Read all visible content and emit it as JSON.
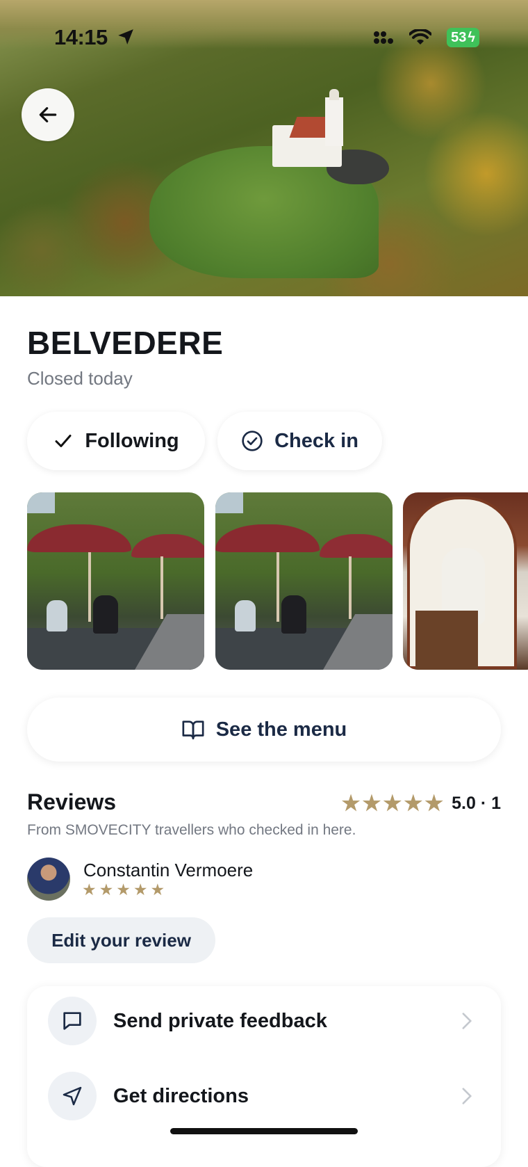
{
  "status_bar": {
    "time": "14:15",
    "battery": "53"
  },
  "venue": {
    "name": "BELVEDERE",
    "status": "Closed today"
  },
  "actions": {
    "following_label": "Following",
    "checkin_label": "Check in",
    "menu_label": "See the menu"
  },
  "photos": [
    "terrace",
    "terrace",
    "interior"
  ],
  "reviews": {
    "title": "Reviews",
    "rating": "5.0 · 1",
    "subtitle": "From SMOVECITY travellers who checked in here.",
    "stars": 5,
    "items": [
      {
        "name": "Constantin Vermoere",
        "stars": 5
      }
    ],
    "edit_label": "Edit your review"
  },
  "links": [
    {
      "label": "Send private feedback",
      "icon": "chat-bubble-icon"
    },
    {
      "label": "Get directions",
      "icon": "navigation-arrow-icon"
    }
  ],
  "colors": {
    "star": "#b39a6a",
    "accent_text": "#1b2a45",
    "battery": "#3fc159"
  }
}
